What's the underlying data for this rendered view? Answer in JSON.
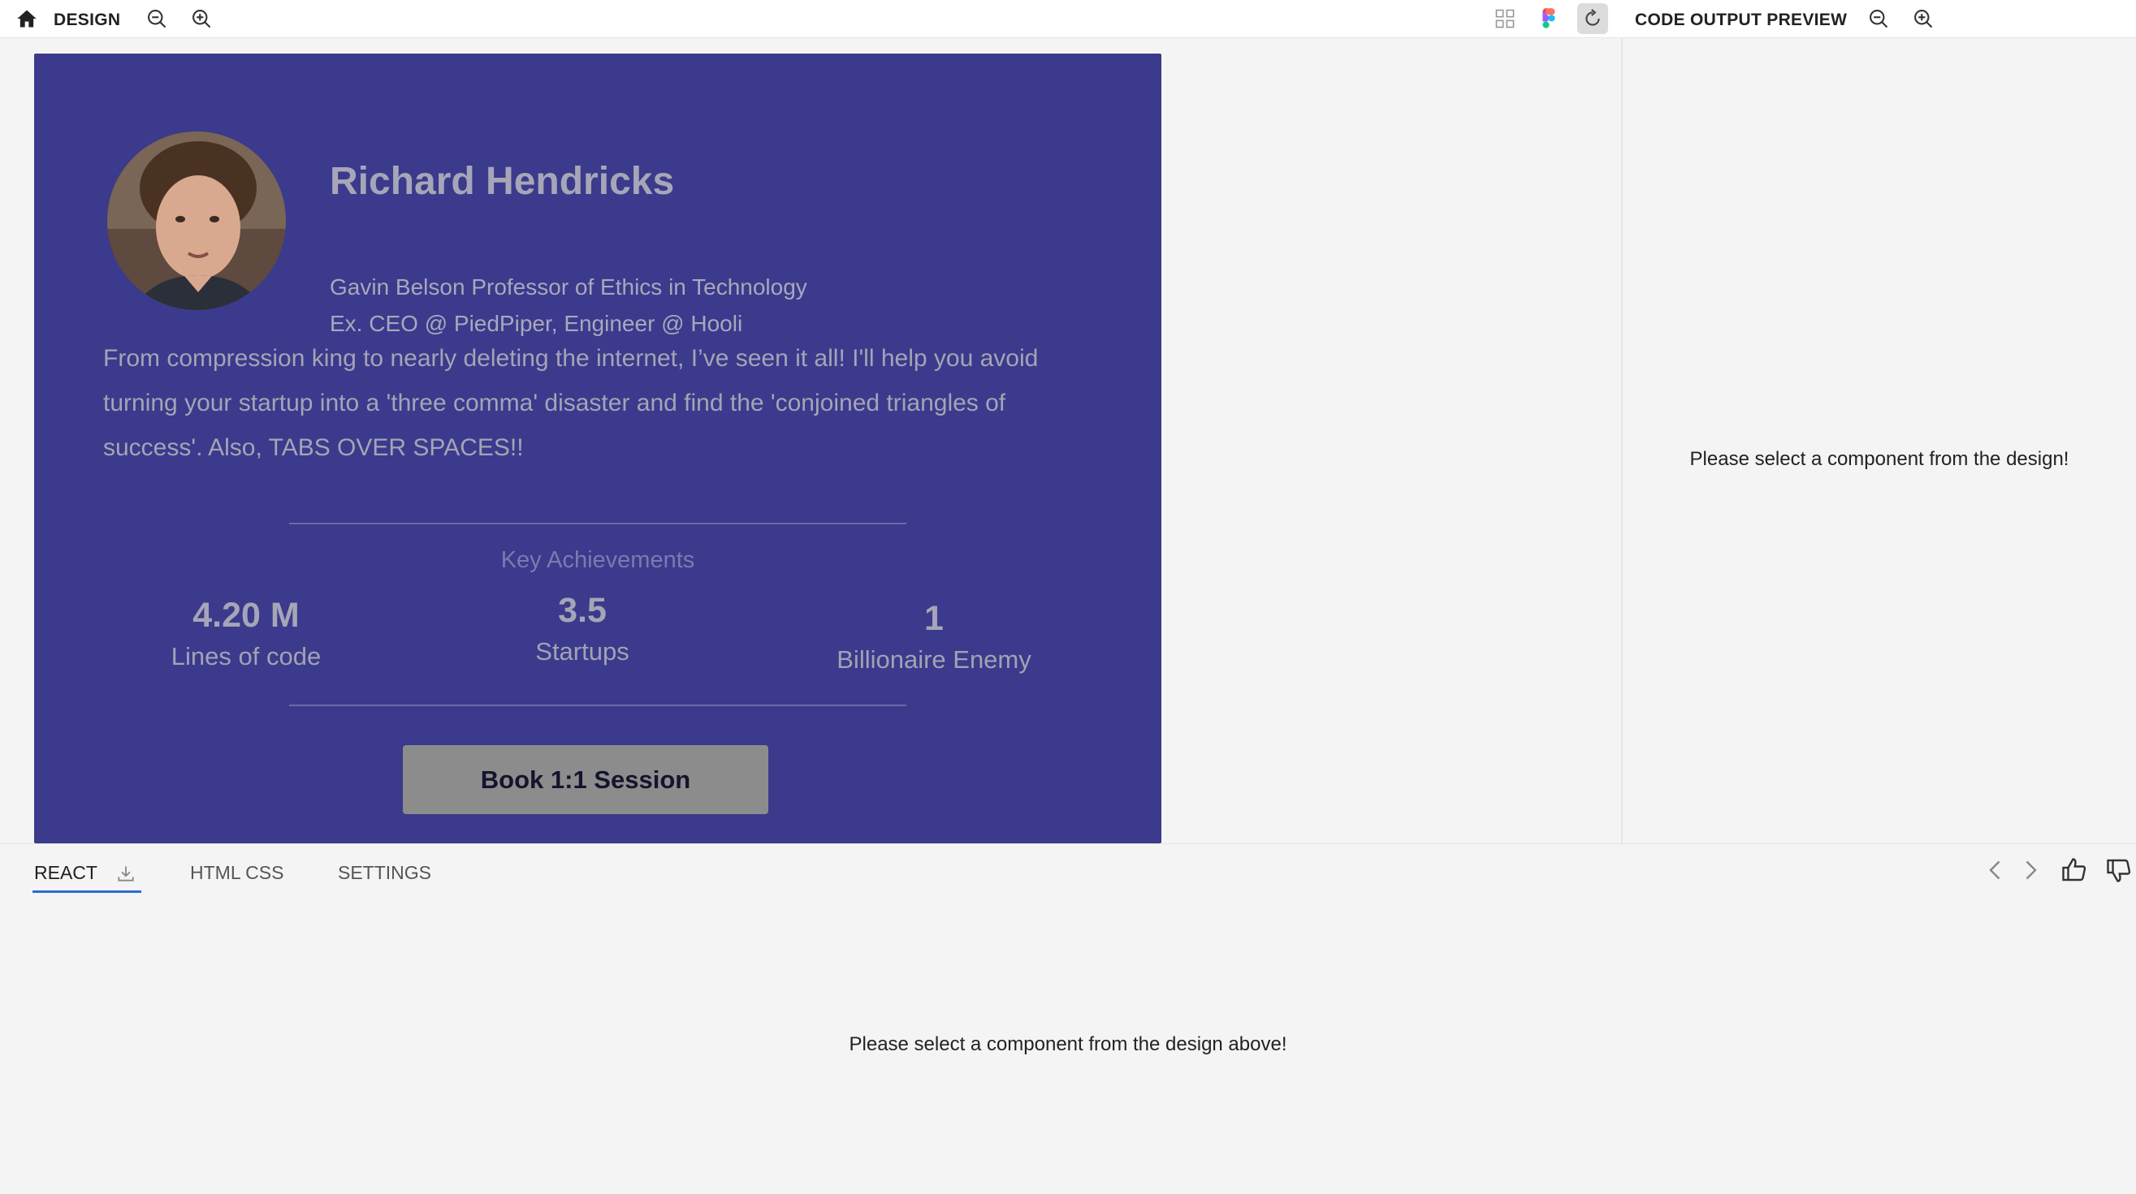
{
  "topbar": {
    "home_icon": "home-icon",
    "design_label": "DESIGN",
    "zoom_out_icon": "zoom-out-icon",
    "zoom_in_icon": "zoom-in-icon",
    "grid_icon": "grid-icon",
    "figma_icon": "figma-icon",
    "refresh_icon": "refresh-icon",
    "preview_label": "CODE OUTPUT PREVIEW"
  },
  "card": {
    "name": "Richard Hendricks",
    "title_line1": "Gavin Belson Professor of Ethics in Technology",
    "title_line2": "Ex. CEO @ PiedPiper, Engineer @ Hooli",
    "bio": "From compression king to nearly deleting the internet, I’ve seen it all! I'll help you avoid turning your startup into a 'three comma' disaster and find the 'conjoined triangles of success'. Also, TABS OVER SPACES!!",
    "achievements_title": "Key Achievements",
    "stats": [
      {
        "value": "4.20 M",
        "label": "Lines of code"
      },
      {
        "value": "3.5",
        "label": "Startups"
      },
      {
        "value": "1",
        "label": "Billionaire Enemy"
      }
    ],
    "button_label": "Book 1:1 Session",
    "colors": {
      "card_bg": "#3b3a8c",
      "button_bg": "#8c8c8c"
    }
  },
  "preview": {
    "message": "Please select a component from the design!"
  },
  "bottom": {
    "tabs": [
      {
        "label": "REACT",
        "active": true
      },
      {
        "label": "HTML CSS",
        "active": false
      },
      {
        "label": "SETTINGS",
        "active": false
      }
    ],
    "message": "Please select a component from the design above!",
    "accent": "#2d6ccf"
  }
}
